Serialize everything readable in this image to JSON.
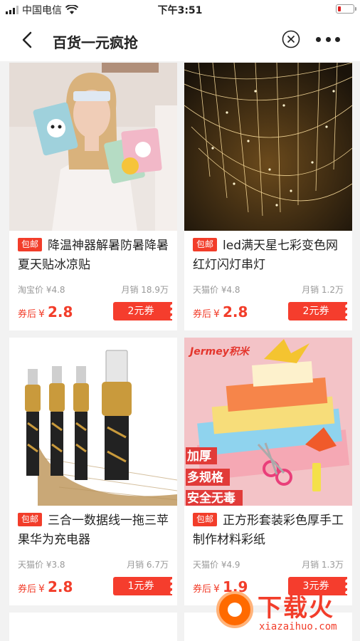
{
  "status_bar": {
    "carrier": "中国电信",
    "time": "下午3:51"
  },
  "nav": {
    "title": "百货一元疯抢"
  },
  "products": [
    {
      "badge": "包邮",
      "title": "降温神器解暑防暑降暑夏天贴冰凉贴",
      "source_price": "淘宝价 ¥4.8",
      "monthly_sales": "月销 18.9万",
      "after_coupon_label": "券后",
      "currency": "¥",
      "final_price": "2.8",
      "coupon": "2元券"
    },
    {
      "badge": "包邮",
      "title": "led满天星七彩变色网红灯闪灯串灯",
      "source_price": "天猫价 ¥4.8",
      "monthly_sales": "月销 1.2万",
      "after_coupon_label": "券后",
      "currency": "¥",
      "final_price": "2.8",
      "coupon": "2元券"
    },
    {
      "badge": "包邮",
      "title": "三合一数据线一拖三苹果华为充电器",
      "source_price": "天猫价 ¥3.8",
      "monthly_sales": "月销 6.7万",
      "after_coupon_label": "券后",
      "currency": "¥",
      "final_price": "2.8",
      "coupon": "1元券"
    },
    {
      "badge": "包邮",
      "title": "正方形套装彩色厚手工制作材料彩纸",
      "source_price": "天猫价 ¥4.9",
      "monthly_sales": "月销 1.3万",
      "after_coupon_label": "券后",
      "currency": "¥",
      "final_price": "1.9",
      "coupon": "3元券",
      "image_text": {
        "brand": "Jermey积米",
        "line1": "加厚",
        "line2": "多规格",
        "line3": "安全无毒"
      }
    }
  ],
  "watermark": {
    "text": "下载火",
    "url": "xiazaihuo.com"
  },
  "colors": {
    "accent": "#f23d2a",
    "page_bg": "#f2f2f2"
  }
}
